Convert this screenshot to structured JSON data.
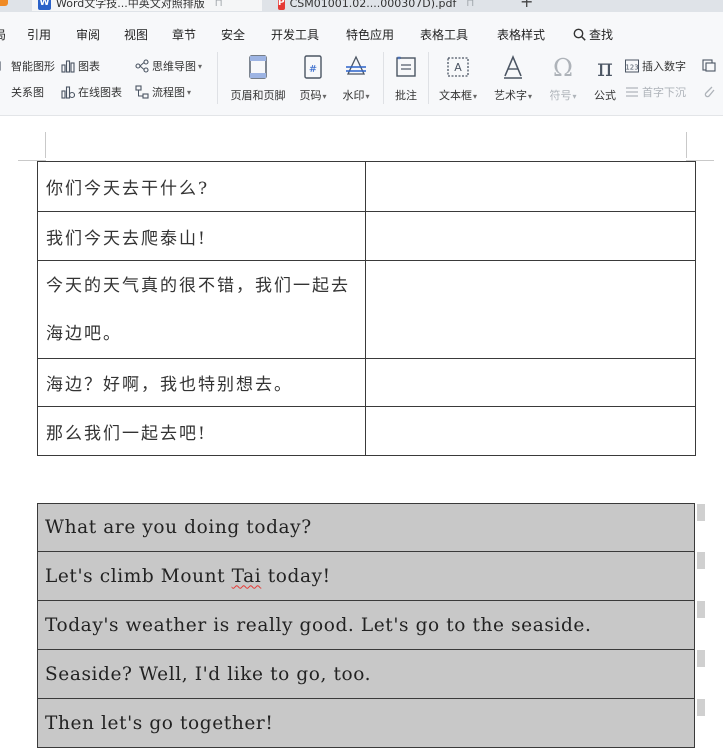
{
  "tabs": [
    {
      "label": "Word文字技...中英文对照排版",
      "icon": "word-doc-icon"
    },
    {
      "label": "CSM01001.02....000307D).pdf",
      "icon": "pdf-doc-icon"
    }
  ],
  "menu": {
    "items": [
      "引用",
      "审阅",
      "视图",
      "章节",
      "安全",
      "开发工具",
      "特色应用",
      "表格工具",
      "表格样式"
    ],
    "search_label": "查找"
  },
  "toolbar": {
    "smart_art": "智能图形",
    "chart": "图表",
    "mind_map": "思维导图",
    "relation_map": "关系图",
    "online_chart": "在线图表",
    "flowchart": "流程图",
    "header_footer": "页眉和页脚",
    "page_number": "页码",
    "watermark": "水印",
    "comment": "批注",
    "textbox": "文本框",
    "wordart": "艺术字",
    "symbol": "符号",
    "formula": "公式",
    "insert_number": "插入数字",
    "drop_cap": "首字下沉"
  },
  "document": {
    "chinese_rows": [
      {
        "c1": "你们今天去干什么?",
        "c2": ""
      },
      {
        "c1": "我们今天去爬泰山!",
        "c2": ""
      },
      {
        "c1": "今天的天气真的很不错，我们一起去海边吧。",
        "c2": ""
      },
      {
        "c1": "海边？好啊，我也特别想去。",
        "c2": ""
      },
      {
        "c1": "那么我们一起去吧!",
        "c2": ""
      }
    ],
    "english_rows": [
      {
        "before": "What are you doing today?",
        "flagged": "",
        "after": ""
      },
      {
        "before": "Let's climb Mount ",
        "flagged": "Tai",
        "after": " today!"
      },
      {
        "before": "Today's weather is really good. Let's go to the seaside.",
        "flagged": "",
        "after": ""
      },
      {
        "before": "Seaside? Well, I'd like to go, too.",
        "flagged": "",
        "after": ""
      },
      {
        "before": "Then let's go together!",
        "flagged": "",
        "after": ""
      }
    ]
  },
  "colors": {
    "ribbon_bg": "#f7f8fa",
    "english_table_fill": "#c8c8c8",
    "spell_underline": "#e53935"
  }
}
